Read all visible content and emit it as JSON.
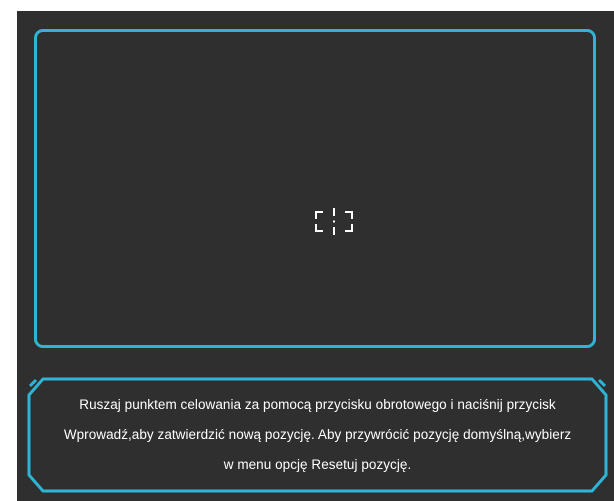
{
  "aim_area": {
    "crosshair_icon": "crosshair-icon"
  },
  "colors": {
    "background": "#2f2f2f",
    "accent": "#2fb4d6",
    "text": "#ffffff"
  },
  "message": {
    "lines": [
      "Ruszaj punktem celowania za pomocą przycisku obrotowego i naciśnij przycisk",
      "Wprowadź,aby zatwierdzić nową pozycję. Aby przywrócić pozycję domyślną,wybierz",
      "w menu opcję Resetuj pozycję."
    ]
  }
}
